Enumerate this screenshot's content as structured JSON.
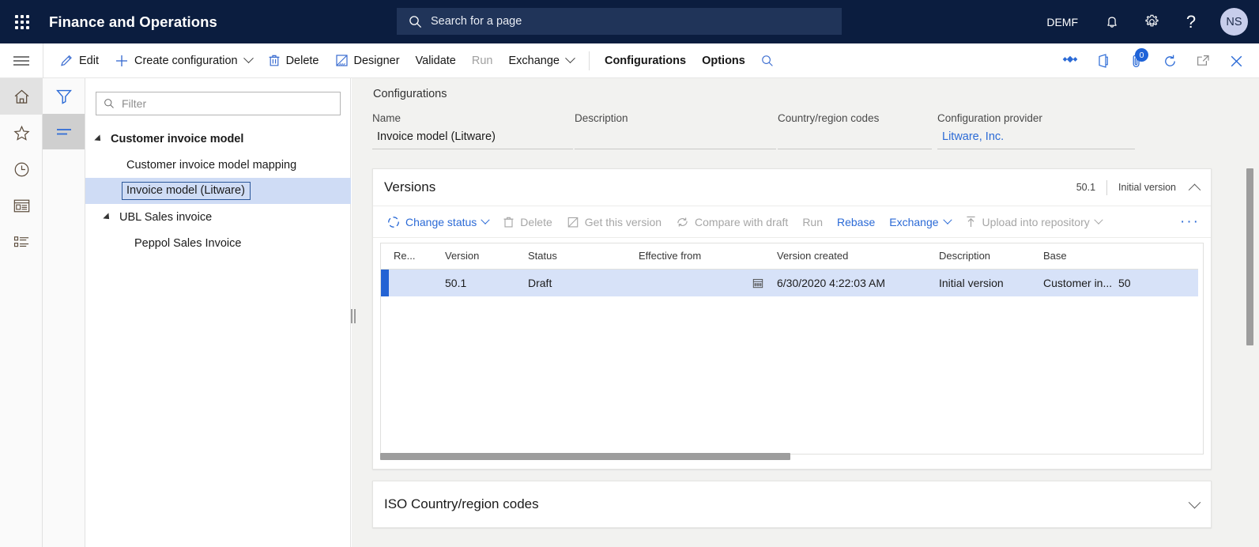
{
  "topbar": {
    "app_title": "Finance and Operations",
    "waffle_icon": "app-launcher-icon",
    "search_placeholder": "Search for a page",
    "search_icon": "search-icon",
    "company": "DEMF",
    "notifications_icon": "bell-icon",
    "settings_icon": "gear-icon",
    "help_icon": "question-mark-icon",
    "avatar_initials": "NS"
  },
  "commandbar": {
    "hamburger_icon": "hamburger-menu-icon",
    "items": [
      {
        "label": "Edit",
        "icon": "pencil-icon",
        "disabled": false,
        "caret": false,
        "bold": false
      },
      {
        "label": "Create configuration",
        "icon": "plus-icon",
        "disabled": false,
        "caret": true,
        "bold": false
      },
      {
        "label": "Delete",
        "icon": "trash-icon",
        "disabled": false,
        "caret": false,
        "bold": false
      },
      {
        "label": "Designer",
        "icon": "designer-icon",
        "disabled": false,
        "caret": false,
        "bold": false
      },
      {
        "label": "Validate",
        "icon": "",
        "disabled": false,
        "caret": false,
        "bold": false
      },
      {
        "label": "Run",
        "icon": "",
        "disabled": true,
        "caret": false,
        "bold": false
      },
      {
        "label": "Exchange",
        "icon": "",
        "disabled": false,
        "caret": true,
        "bold": false
      }
    ],
    "tabs": [
      {
        "label": "Configurations"
      },
      {
        "label": "Options"
      }
    ],
    "search_icon": "search-icon",
    "right_icons": [
      {
        "name": "power-apps-icon",
        "badge": ""
      },
      {
        "name": "office-app-icon",
        "badge": ""
      },
      {
        "name": "attachments-icon",
        "badge": "0"
      },
      {
        "name": "refresh-icon",
        "badge": ""
      },
      {
        "name": "popout-icon",
        "badge": ""
      },
      {
        "name": "close-icon",
        "badge": ""
      }
    ]
  },
  "rail": {
    "items": [
      {
        "name": "home-icon",
        "active": true
      },
      {
        "name": "favorites-star-icon",
        "active": false
      },
      {
        "name": "recent-clock-icon",
        "active": false
      },
      {
        "name": "workspaces-icon",
        "active": false
      },
      {
        "name": "modules-list-icon",
        "active": false
      }
    ]
  },
  "rail2": {
    "items": [
      {
        "name": "filter-funnel-icon",
        "active": false
      },
      {
        "name": "tree-list-icon",
        "active": true
      }
    ]
  },
  "tree": {
    "filter_placeholder": "Filter",
    "filter_value": "",
    "filter_icon": "search-icon",
    "nodes": [
      {
        "label": "Customer invoice model",
        "level": 0,
        "expandable": true,
        "selected": false,
        "focused": false
      },
      {
        "label": "Customer invoice model mapping",
        "level": 1,
        "expandable": false,
        "selected": false,
        "focused": false
      },
      {
        "label": "Invoice model (Litware)",
        "level": 1,
        "expandable": false,
        "selected": true,
        "focused": true
      },
      {
        "label": "UBL Sales invoice",
        "level": 0,
        "expandable": true,
        "selected": false,
        "focused": false
      },
      {
        "label": "Peppol Sales Invoice",
        "level": 1,
        "expandable": false,
        "selected": false,
        "focused": false
      }
    ]
  },
  "main": {
    "breadcrumb": "Configurations",
    "fields": {
      "name_label": "Name",
      "name_value": "Invoice model (Litware)",
      "description_label": "Description",
      "description_value": "",
      "country_label": "Country/region codes",
      "country_value": "",
      "provider_label": "Configuration provider",
      "provider_value": "Litware, Inc."
    },
    "versions_card": {
      "title": "Versions",
      "summary_version": "50.1",
      "summary_description": "Initial version",
      "collapse_icon": "chevron-up-icon",
      "toolbar": [
        {
          "label": "Change status",
          "icon": "status-spinner-icon",
          "disabled": false,
          "caret": true
        },
        {
          "label": "Delete",
          "icon": "trash-icon",
          "disabled": true,
          "caret": false
        },
        {
          "label": "Get this version",
          "icon": "get-version-icon",
          "disabled": true,
          "caret": false
        },
        {
          "label": "Compare with draft",
          "icon": "compare-icon",
          "disabled": true,
          "caret": false
        },
        {
          "label": "Run",
          "icon": "",
          "disabled": true,
          "caret": false
        },
        {
          "label": "Rebase",
          "icon": "",
          "disabled": false,
          "caret": false
        },
        {
          "label": "Exchange",
          "icon": "",
          "disabled": false,
          "caret": true
        },
        {
          "label": "Upload into repository",
          "icon": "upload-icon",
          "disabled": true,
          "caret": true
        }
      ],
      "overflow_label": "···",
      "columns": [
        "Re...",
        "Version",
        "Status",
        "Effective from",
        "Version created",
        "Description",
        "Base",
        ""
      ],
      "rows": [
        {
          "selected": true,
          "re": "",
          "version": "50.1",
          "status": "Draft",
          "effective_from": "",
          "effective_from_icon": "calendar-icon",
          "version_created": "6/30/2020 4:22:03 AM",
          "description": "Initial version",
          "base": "Customer in...",
          "base_version": "50"
        }
      ]
    },
    "iso_card": {
      "title": "ISO Country/region codes",
      "expand_icon": "chevron-down-icon"
    }
  }
}
